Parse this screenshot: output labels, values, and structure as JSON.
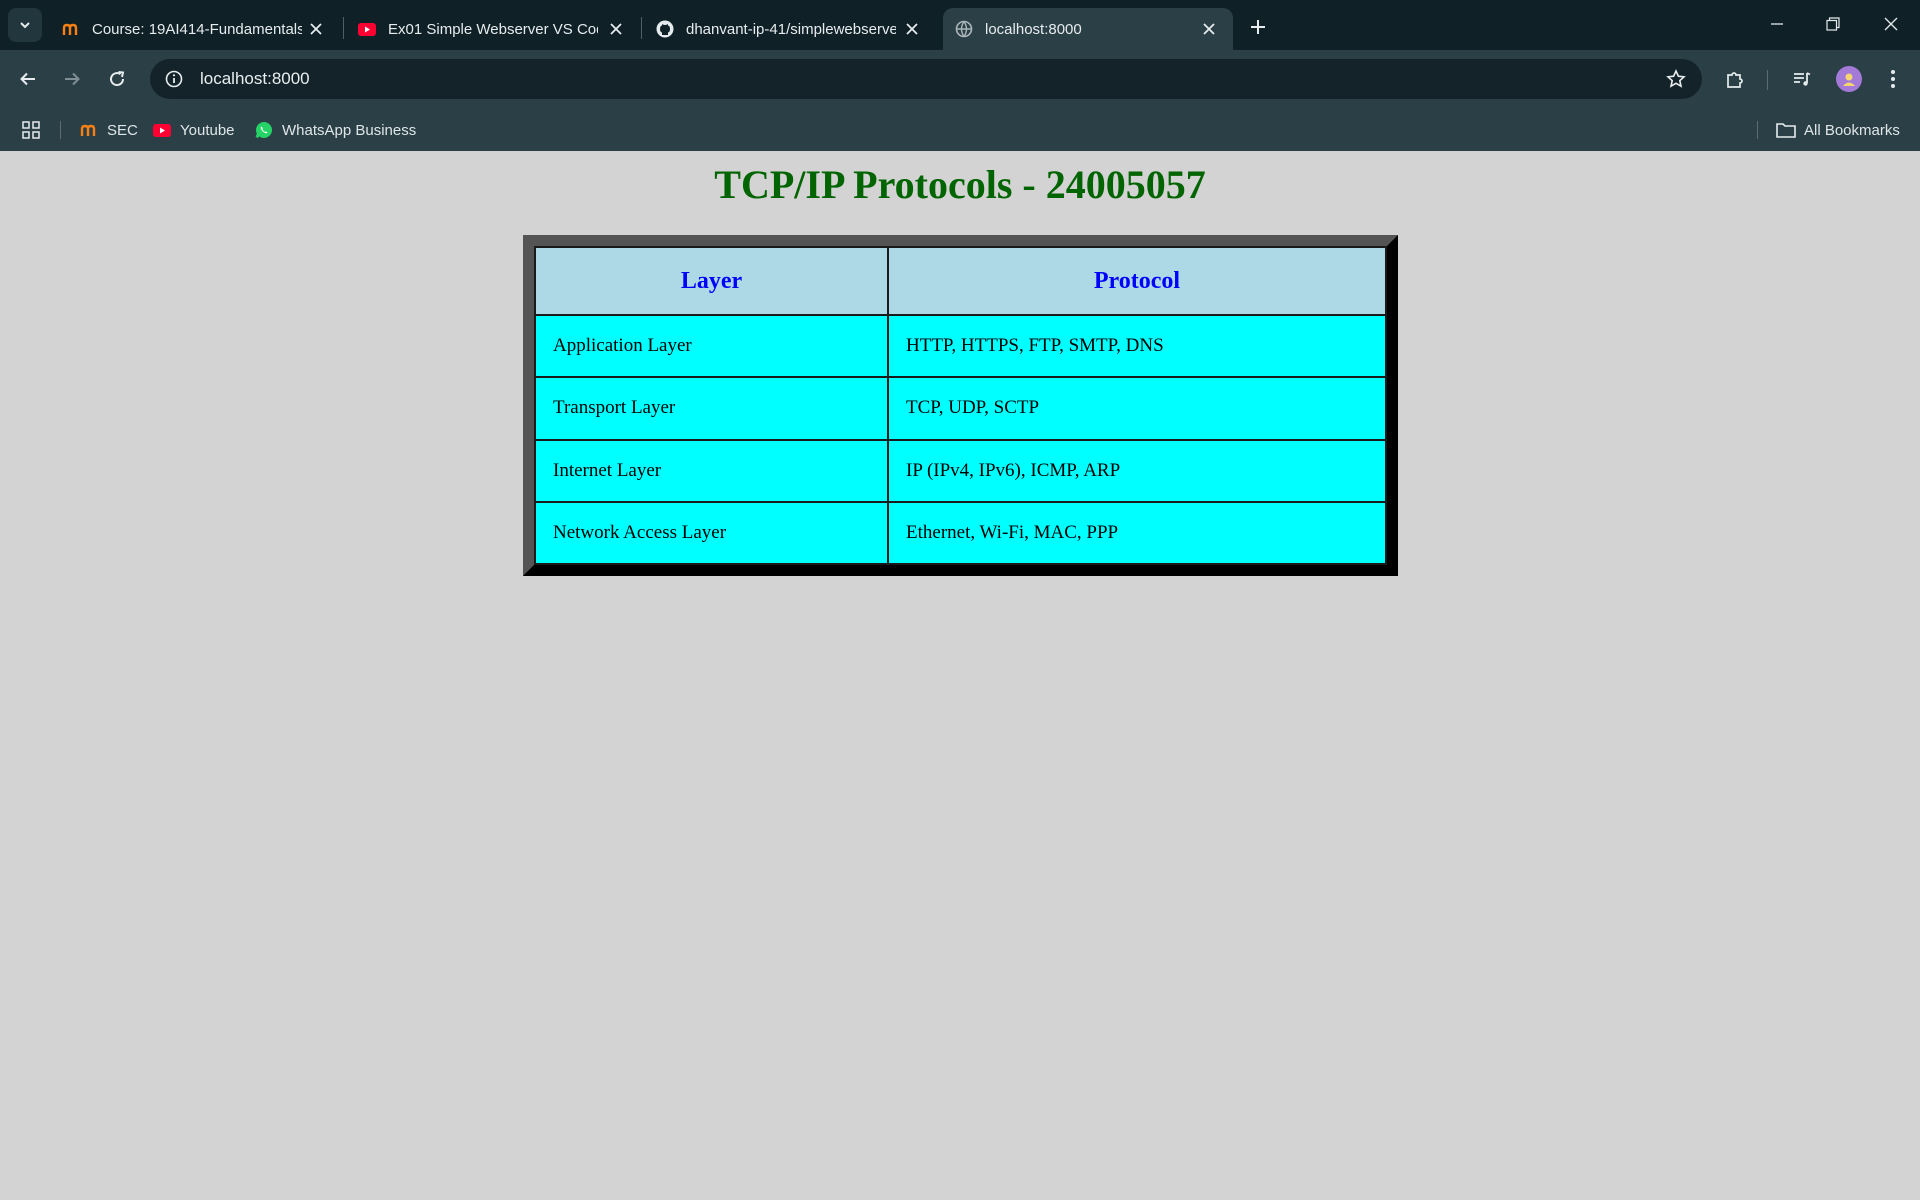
{
  "browser": {
    "tabs": [
      {
        "title": "Course: 19AI414-Fundamentals",
        "icon": "moodle-icon"
      },
      {
        "title": "Ex01 Simple Webserver VS Code",
        "icon": "youtube-icon"
      },
      {
        "title": "dhanvant-ip-41/simplewebserver",
        "icon": "github-icon"
      },
      {
        "title": "localhost:8000",
        "icon": "globe-icon",
        "active": true
      }
    ],
    "address": "localhost:8000",
    "bookmarks": [
      {
        "label": "SEC",
        "icon": "moodle-icon"
      },
      {
        "label": "Youtube",
        "icon": "youtube-icon"
      },
      {
        "label": "WhatsApp Business",
        "icon": "whatsapp-icon"
      }
    ],
    "all_bookmarks": "All Bookmarks"
  },
  "page": {
    "heading": "TCP/IP Protocols - 24005057",
    "table": {
      "headers": [
        "Layer",
        "Protocol"
      ],
      "rows": [
        [
          "Application Layer",
          "HTTP, HTTPS, FTP, SMTP, DNS"
        ],
        [
          "Transport Layer",
          "TCP, UDP, SCTP"
        ],
        [
          "Internet Layer",
          "IP (IPv4, IPv6), ICMP, ARP"
        ],
        [
          "Network Access Layer",
          "Ethernet, Wi-Fi, MAC, PPP"
        ]
      ]
    }
  },
  "colors": {
    "heading": "#006400",
    "header_bg": "#add8e6",
    "header_text": "#0000ff",
    "cell_bg": "#00ffff",
    "page_bg": "#d3d3d3"
  }
}
